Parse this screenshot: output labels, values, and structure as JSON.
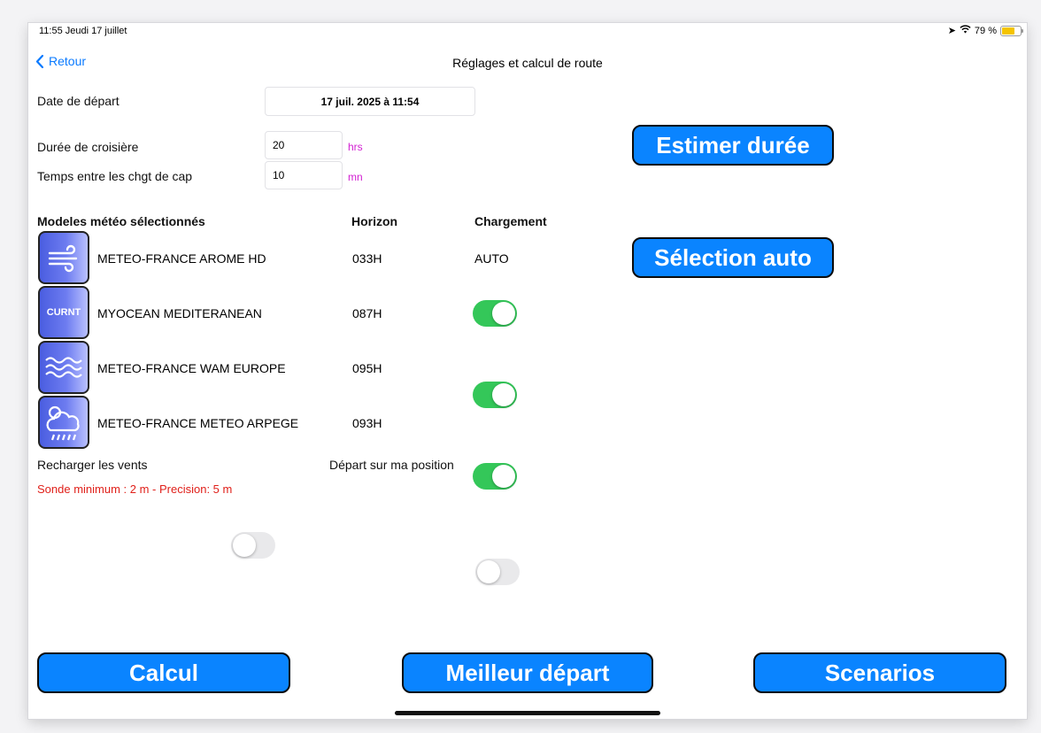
{
  "status_bar": {
    "time_date": "11:55  Jeudi 17 juillet",
    "battery_text": "79 %",
    "battery_level": 0.79
  },
  "nav": {
    "back_label": "Retour",
    "title": "Réglages et calcul de route"
  },
  "form": {
    "date_label": "Date de départ",
    "date_value": "17 juil. 2025 à 11:54",
    "duration_label": "Durée de croisière",
    "duration_value": "20",
    "duration_unit": "hrs",
    "heading_label": "Temps entre les chgt de cap",
    "heading_value": "10",
    "heading_unit": "mn"
  },
  "buttons": {
    "estimate": "Estimer durée",
    "auto_select": "Sélection auto",
    "calc": "Calcul",
    "best_departure": "Meilleur départ",
    "scenarios": "Scenarios"
  },
  "models_table": {
    "headers": {
      "model": "Modeles météo sélectionnés",
      "horizon": "Horizon",
      "loading": "Chargement"
    },
    "rows": [
      {
        "icon": "wind-icon",
        "name": "METEO-FRANCE AROME HD",
        "horizon": "033H",
        "loading": "AUTO",
        "toggle": null
      },
      {
        "icon": "current-icon",
        "icon_text": "CURNT",
        "name": "MYOCEAN MEDITERANEAN",
        "horizon": "087H",
        "loading": "",
        "toggle": true
      },
      {
        "icon": "waves-icon",
        "name": "METEO-FRANCE WAM EUROPE",
        "horizon": "095H",
        "loading": "",
        "toggle": true
      },
      {
        "icon": "cloud-rain-icon",
        "name": "METEO-FRANCE METEO ARPEGE",
        "horizon": "093H",
        "loading": "",
        "toggle": true
      }
    ]
  },
  "options": {
    "reload_winds_label": "Recharger les vents",
    "reload_winds_on": false,
    "depart_position_label": "Départ sur ma position",
    "depart_position_on": false
  },
  "sonde_text": "Sonde minimum : 2 m - Precision: 5 m",
  "colors": {
    "accent": "#0a84ff",
    "toggle_on": "#34c759",
    "unit": "#d21fd2",
    "warning": "#e0201a"
  }
}
